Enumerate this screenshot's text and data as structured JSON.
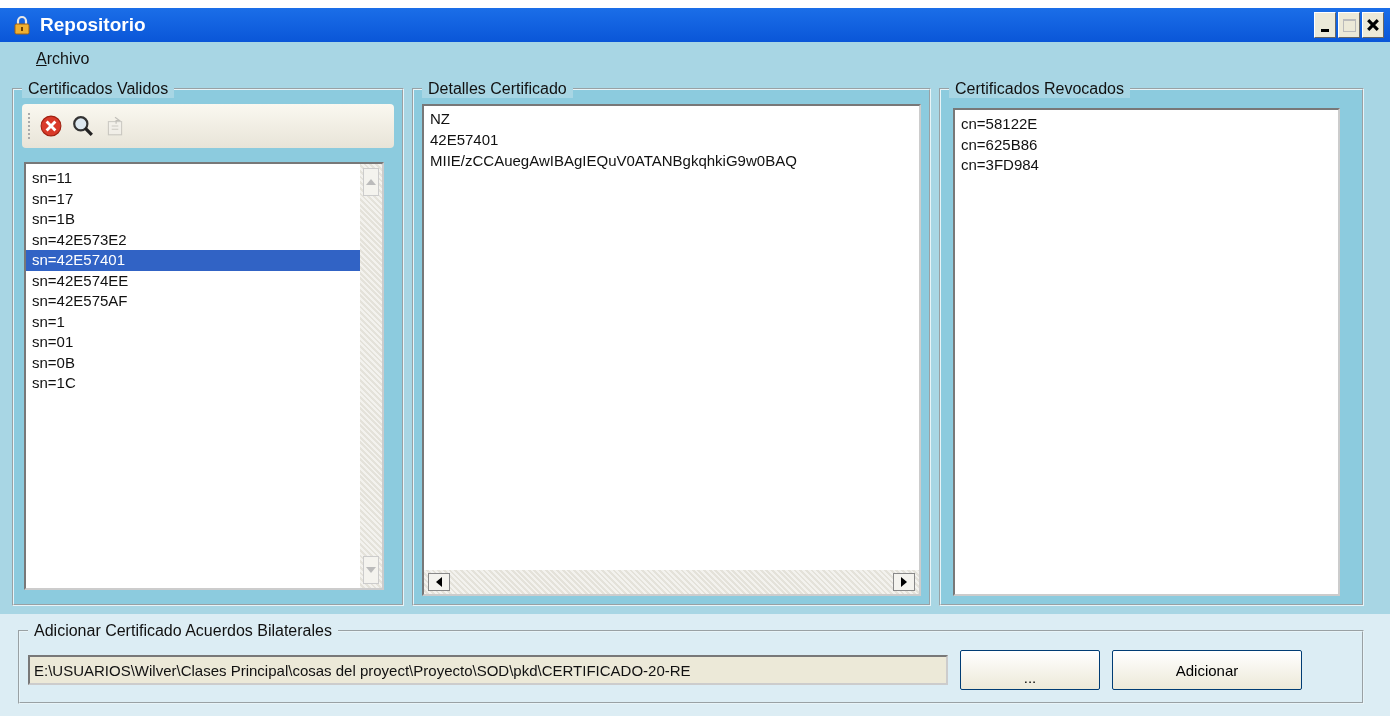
{
  "window": {
    "title": "Repositorio",
    "controls": [
      {
        "kind": "minimize",
        "disabled": false
      },
      {
        "kind": "maximize",
        "disabled": true
      },
      {
        "kind": "close",
        "disabled": false
      }
    ]
  },
  "menu": [
    {
      "label": "Archivo"
    }
  ],
  "valid": {
    "title": "Certificados Validos",
    "toolbar": [
      {
        "kind": "delete",
        "disabled": false
      },
      {
        "kind": "search",
        "disabled": false
      },
      {
        "kind": "export",
        "disabled": true
      }
    ],
    "items": [
      {
        "label": "sn=11",
        "selected": false
      },
      {
        "label": "sn=17",
        "selected": false
      },
      {
        "label": "sn=1B",
        "selected": false
      },
      {
        "label": "sn=42E573E2",
        "selected": false
      },
      {
        "label": "sn=42E57401",
        "selected": true
      },
      {
        "label": "sn=42E574EE",
        "selected": false
      },
      {
        "label": "sn=42E575AF",
        "selected": false
      },
      {
        "label": "sn=1",
        "selected": false
      },
      {
        "label": "sn=01",
        "selected": false
      },
      {
        "label": "sn=0B",
        "selected": false
      },
      {
        "label": "sn=1C",
        "selected": false
      }
    ]
  },
  "details": {
    "title": "Detalles Certificado",
    "lines": [
      "NZ",
      "42E57401",
      "MIIE/zCCAuegAwIBAgIEQuV0ATANBgkqhkiG9w0BAQ"
    ]
  },
  "revoked": {
    "title": "Certificados Revocados",
    "items": [
      "cn=58122E",
      "cn=625B86",
      "cn=3FD984"
    ]
  },
  "add": {
    "title": "Adicionar Certificado Acuerdos Bilaterales",
    "path": "E:\\USUARIOS\\Wilver\\Clases Principal\\cosas del proyect\\Proyecto\\SOD\\pkd\\CERTIFICADO-20-RE",
    "browse": "...",
    "submit": "Adicionar"
  }
}
